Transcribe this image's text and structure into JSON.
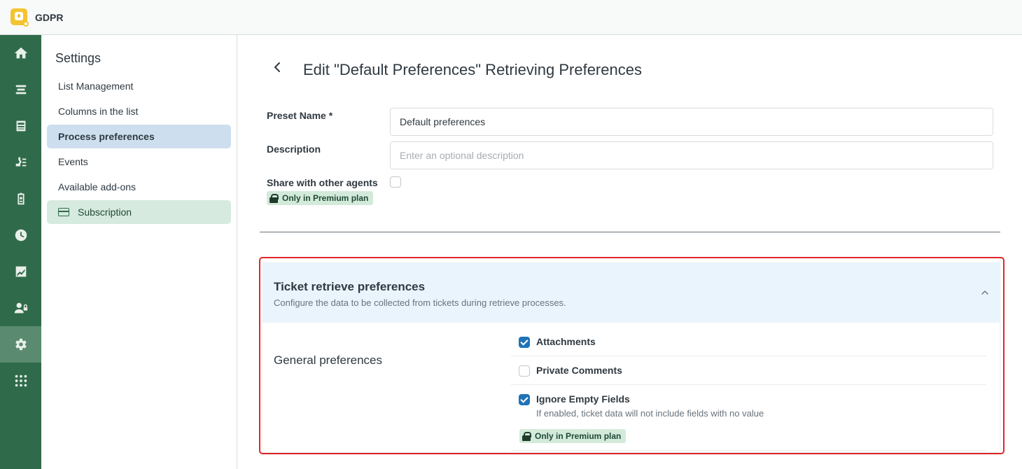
{
  "app": {
    "name": "GDPR"
  },
  "rail": {
    "items": [
      {
        "icon": "home-icon"
      },
      {
        "icon": "list-icon"
      },
      {
        "icon": "inbox-icon"
      },
      {
        "icon": "user-data-icon"
      },
      {
        "icon": "clipboard-icon"
      },
      {
        "icon": "clock-icon"
      },
      {
        "icon": "chart-icon"
      },
      {
        "icon": "user-lock-icon"
      },
      {
        "icon": "gear-icon",
        "active": true
      },
      {
        "icon": "apps-grid-icon"
      }
    ]
  },
  "sidebar": {
    "title": "Settings",
    "items": [
      {
        "label": "List Management"
      },
      {
        "label": "Columns in the list"
      },
      {
        "label": "Process preferences",
        "active": true
      },
      {
        "label": "Events"
      },
      {
        "label": "Available add-ons"
      },
      {
        "label": "Subscription",
        "icon": "credit-card-icon"
      }
    ]
  },
  "page": {
    "title": "Edit \"Default Preferences\" Retrieving Preferences"
  },
  "form": {
    "preset_name_label": "Preset Name *",
    "preset_name_value": "Default preferences",
    "description_label": "Description",
    "description_placeholder": "Enter an optional description",
    "share_label": "Share with other agents",
    "premium_badge": "Only in Premium plan"
  },
  "section": {
    "title": "Ticket retrieve preferences",
    "subtitle": "Configure the data to be collected from tickets during retrieve processes.",
    "group_label": "General preferences",
    "options": [
      {
        "label": "Attachments",
        "checked": true
      },
      {
        "label": "Private Comments",
        "checked": false
      },
      {
        "label": "Ignore Empty Fields",
        "checked": true,
        "hint": "If enabled, ticket data will not include fields with no value",
        "badge": "Only in Premium plan"
      }
    ]
  },
  "colors": {
    "rail": "#2f6b4a",
    "accent": "#1f73b7",
    "highlight": "#e0262b",
    "premium_badge_bg": "#d3eadb"
  }
}
